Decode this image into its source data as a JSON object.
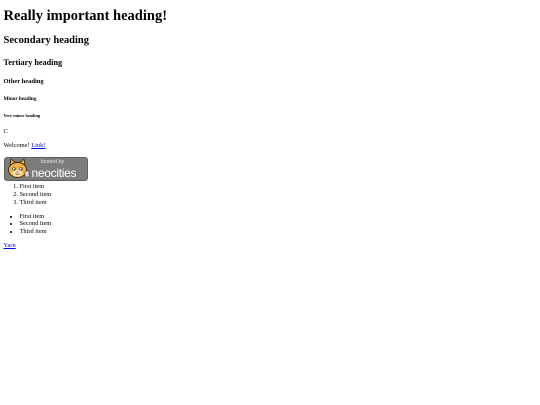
{
  "headings": {
    "h1": "Really important heading!",
    "h2": "Secondary heading",
    "h3": "Tertiary heading",
    "h4": "Other heading",
    "h5": "Minor heading",
    "h6": "Very minor heading"
  },
  "single_letter": "C",
  "welcome": {
    "text": "Welcome! ",
    "link_label": "Link!"
  },
  "badge": {
    "small_text": "hosted by",
    "big_text": "neocities",
    "icon": "neocities-cat-icon"
  },
  "ordered_list": [
    "First item",
    "Second item",
    "Third item"
  ],
  "unordered_list": [
    "First item",
    "Second item",
    "Third item"
  ],
  "footer_link": "Yarn"
}
